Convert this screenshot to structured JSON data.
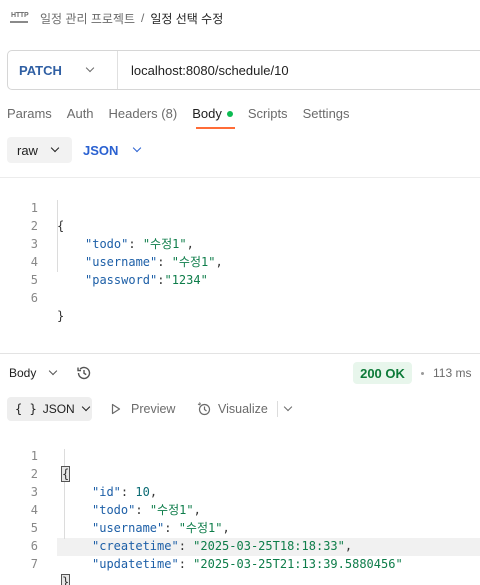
{
  "breadcrumb": {
    "icon": "http-icon",
    "icon_text": "HTTP",
    "parent": "일정 관리 프로젝트",
    "separator": "/",
    "current": "일정 선택 수정"
  },
  "request": {
    "method": "PATCH",
    "url": "localhost:8080/schedule/10"
  },
  "tabs": [
    {
      "label": "Params"
    },
    {
      "label": "Auth"
    },
    {
      "label": "Headers (8)"
    },
    {
      "label": "Body",
      "active": true,
      "dot_color": "#0cbb52"
    },
    {
      "label": "Scripts"
    },
    {
      "label": "Settings"
    }
  ],
  "body_type": {
    "raw": "raw",
    "format": "JSON"
  },
  "request_body": {
    "line_numbers": [
      "1",
      "2",
      "3",
      "4",
      "5",
      "6"
    ],
    "lines": [
      {
        "open": "{"
      },
      {
        "key": "\"todo\"",
        "sep": ": ",
        "value": "\"수정1\"",
        "end": ","
      },
      {
        "key": "\"username\"",
        "sep": ": ",
        "value": "\"수정1\"",
        "end": ","
      },
      {
        "key": "\"password\"",
        "sep": ":",
        "value": "\"1234\"",
        "end": ""
      },
      {
        "blank": ""
      },
      {
        "close": "}"
      }
    ]
  },
  "response": {
    "label": "Body",
    "status": "200 OK",
    "status_color": "#0c7a38",
    "time": "113 ms",
    "format_button": "JSON",
    "format_braces": "{ }",
    "preview": "Preview",
    "visualize": "Visualize",
    "line_numbers": [
      "1",
      "2",
      "3",
      "4",
      "5",
      "6",
      "7"
    ],
    "lines": [
      {
        "open": "{"
      },
      {
        "key": "\"id\"",
        "sep": ": ",
        "value": "10",
        "type": "num",
        "end": ","
      },
      {
        "key": "\"todo\"",
        "sep": ": ",
        "value": "\"수정1\"",
        "type": "str",
        "end": ","
      },
      {
        "key": "\"username\"",
        "sep": ": ",
        "value": "\"수정1\"",
        "type": "str",
        "end": ","
      },
      {
        "key": "\"createtime\"",
        "sep": ": ",
        "value": "\"2025-03-25T18:18:33\"",
        "type": "str",
        "end": ","
      },
      {
        "key": "\"updatetime\"",
        "sep": ": ",
        "value": "\"2025-03-25T21:13:39.5880456\"",
        "type": "str",
        "end": ""
      },
      {
        "close": "}"
      }
    ]
  },
  "colors": {
    "accent": "#ff6c37",
    "method": "#2f5fa3",
    "json_key": "#1d5fa7",
    "json_string": "#0e7d4a",
    "json_number": "#0b6b74"
  }
}
